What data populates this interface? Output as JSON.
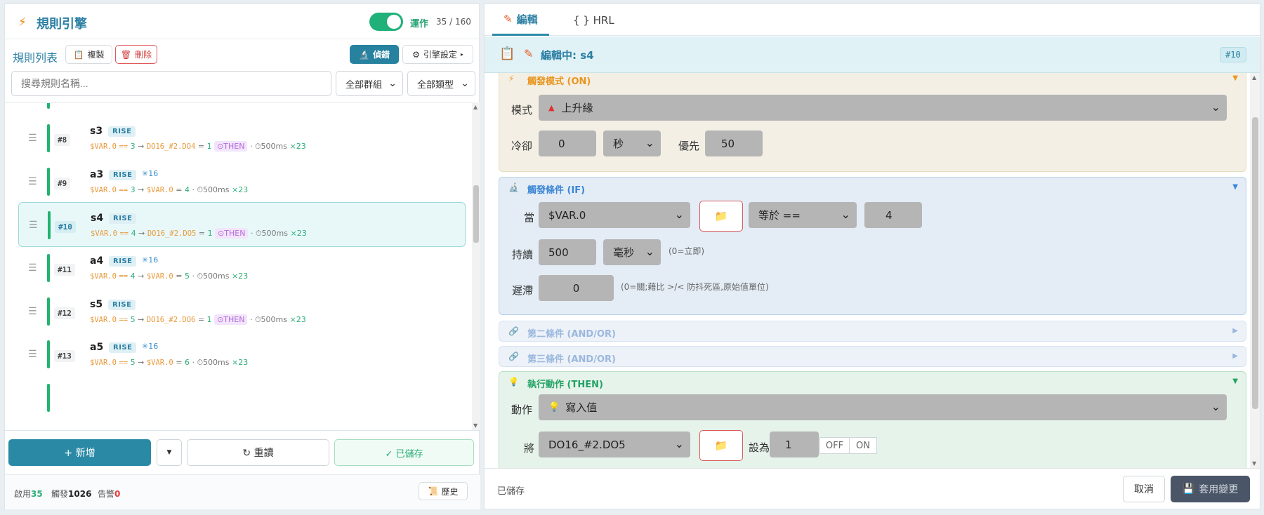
{
  "left": {
    "header": {
      "title": "規則引擎",
      "run_label": "運作",
      "run_count": "35 / 160"
    },
    "toolbar": {
      "list_title": "規則列表",
      "copy": "複製",
      "delete": "刪除",
      "debug": "偵錯",
      "engine": "引擎設定"
    },
    "search": {
      "placeholder": "搜尋規則名稱..."
    },
    "filters": {
      "group": "全部群組",
      "type": "全部類型"
    },
    "rules": [
      {
        "idx": "#8",
        "name": "s3",
        "badge": "RISE",
        "star": "",
        "src": "$VAR.0",
        "op": "==",
        "cmp": "3",
        "tgt": "DO16_#2.DO4",
        "set": "1",
        "then": "⊙THEN",
        "delay": "⏱500ms",
        "count": "×23"
      },
      {
        "idx": "#9",
        "name": "a3",
        "badge": "RISE",
        "star": "✳16",
        "src": "$VAR.0",
        "op": "==",
        "cmp": "3",
        "tgt": "$VAR.0",
        "set": "4",
        "then": "",
        "delay": "⏱500ms",
        "count": "×23"
      },
      {
        "idx": "#10",
        "name": "s4",
        "badge": "RISE",
        "star": "",
        "src": "$VAR.0",
        "op": "==",
        "cmp": "4",
        "tgt": "DO16_#2.DO5",
        "set": "1",
        "then": "⊙THEN",
        "delay": "⏱500ms",
        "count": "×23"
      },
      {
        "idx": "#11",
        "name": "a4",
        "badge": "RISE",
        "star": "✳16",
        "src": "$VAR.0",
        "op": "==",
        "cmp": "4",
        "tgt": "$VAR.0",
        "set": "5",
        "then": "",
        "delay": "⏱500ms",
        "count": "×23"
      },
      {
        "idx": "#12",
        "name": "s5",
        "badge": "RISE",
        "star": "",
        "src": "$VAR.0",
        "op": "==",
        "cmp": "5",
        "tgt": "DO16_#2.DO6",
        "set": "1",
        "then": "⊙THEN",
        "delay": "⏱500ms",
        "count": "×23"
      },
      {
        "idx": "#13",
        "name": "a5",
        "badge": "RISE",
        "star": "✳16",
        "src": "$VAR.0",
        "op": "==",
        "cmp": "5",
        "tgt": "$VAR.0",
        "set": "6",
        "then": "",
        "delay": "⏱500ms",
        "count": "×23"
      }
    ],
    "footer": {
      "add": "+ 新增",
      "reload": "↻ 重讀",
      "saved": "✓ 已儲存",
      "history": "歷史"
    },
    "stats": {
      "enabled_label": "啟用",
      "enabled": "35",
      "fired_label": "觸發",
      "fired": "1026",
      "alarm_label": "告警",
      "alarm": "0"
    }
  },
  "right": {
    "tabs": {
      "edit": "編輯",
      "hrl": "{ } HRL"
    },
    "editing": {
      "title": "編輯中: s4",
      "idx": "#10"
    },
    "trigger": {
      "title": "觸發模式 (ON)",
      "mode_label": "模式",
      "mode_value": "上升緣",
      "cooldown_label": "冷卻",
      "cooldown_value": "0",
      "cooldown_unit": "秒",
      "priority_label": "優先",
      "priority_value": "50"
    },
    "condition": {
      "title": "觸發條件 (IF)",
      "when_label": "當",
      "when_var": "$VAR.0",
      "op": "等於 ==",
      "value": "4",
      "hold_label": "持續",
      "hold_value": "500",
      "hold_unit": "毫秒",
      "hold_hint": "(0=立即)",
      "hyst_label": "遲滯",
      "hyst_value": "0",
      "hyst_hint": "(0=關;藉比 >/< 防抖死區,原始值單位)"
    },
    "cond2": {
      "title": "第二條件 (AND/OR)"
    },
    "cond3": {
      "title": "第三條件 (AND/OR)"
    },
    "action": {
      "title": "執行動作 (THEN)",
      "action_label": "動作",
      "action_value": "寫入值",
      "target_label": "將",
      "target_value": "DO16_#2.DO5",
      "set_label": "設為",
      "set_value": "1",
      "off": "OFF",
      "on": "ON"
    },
    "footer": {
      "status": "已儲存",
      "cancel": "取消",
      "apply": "套用變更"
    }
  },
  "colors": {
    "accent": "#2b8aa6",
    "success": "#22b36f",
    "warning": "#e8951e",
    "danger": "#d23c3c"
  }
}
